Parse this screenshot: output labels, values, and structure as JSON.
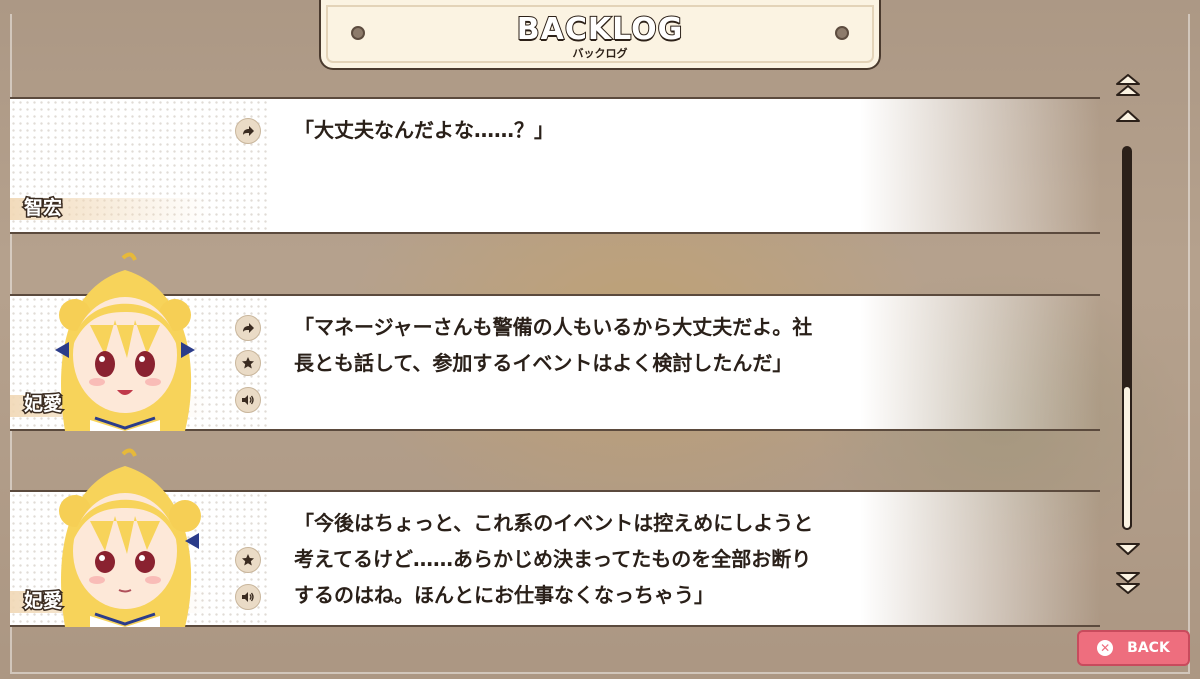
{
  "header": {
    "title": "BACKLOG",
    "subtitle": "バックログ"
  },
  "entries": [
    {
      "speaker": "智宏",
      "has_portrait": false,
      "lines": [
        "「大丈夫なんだよな……？」"
      ],
      "icons": [
        "jump-icon"
      ]
    },
    {
      "speaker": "妃愛",
      "has_portrait": true,
      "expression": "smiling",
      "lines": [
        "「マネージャーさんも警備の人もいるから大丈夫だよ。社",
        "長とも話して、参加するイベントはよく検討したんだ」"
      ],
      "icons": [
        "jump-icon",
        "star-icon",
        "voice-icon"
      ]
    },
    {
      "speaker": "妃愛",
      "has_portrait": true,
      "expression": "calm",
      "lines": [
        "「今後はちょっと、これ系のイベントは控えめにしようと",
        "考えてるけど……あらかじめ決まってたものを全部お断り",
        "するのはね。ほんとにお仕事なくなっちゃう」"
      ],
      "icons": [
        "star-icon",
        "voice-icon"
      ]
    }
  ],
  "scrollbar": {
    "position_fraction": 0.65
  },
  "back_button": {
    "label": "BACK",
    "icon": "close-icon"
  },
  "colors": {
    "text": "#2a2019",
    "accent_back": "#ee6e7e",
    "panel": "#fbf3e2"
  }
}
